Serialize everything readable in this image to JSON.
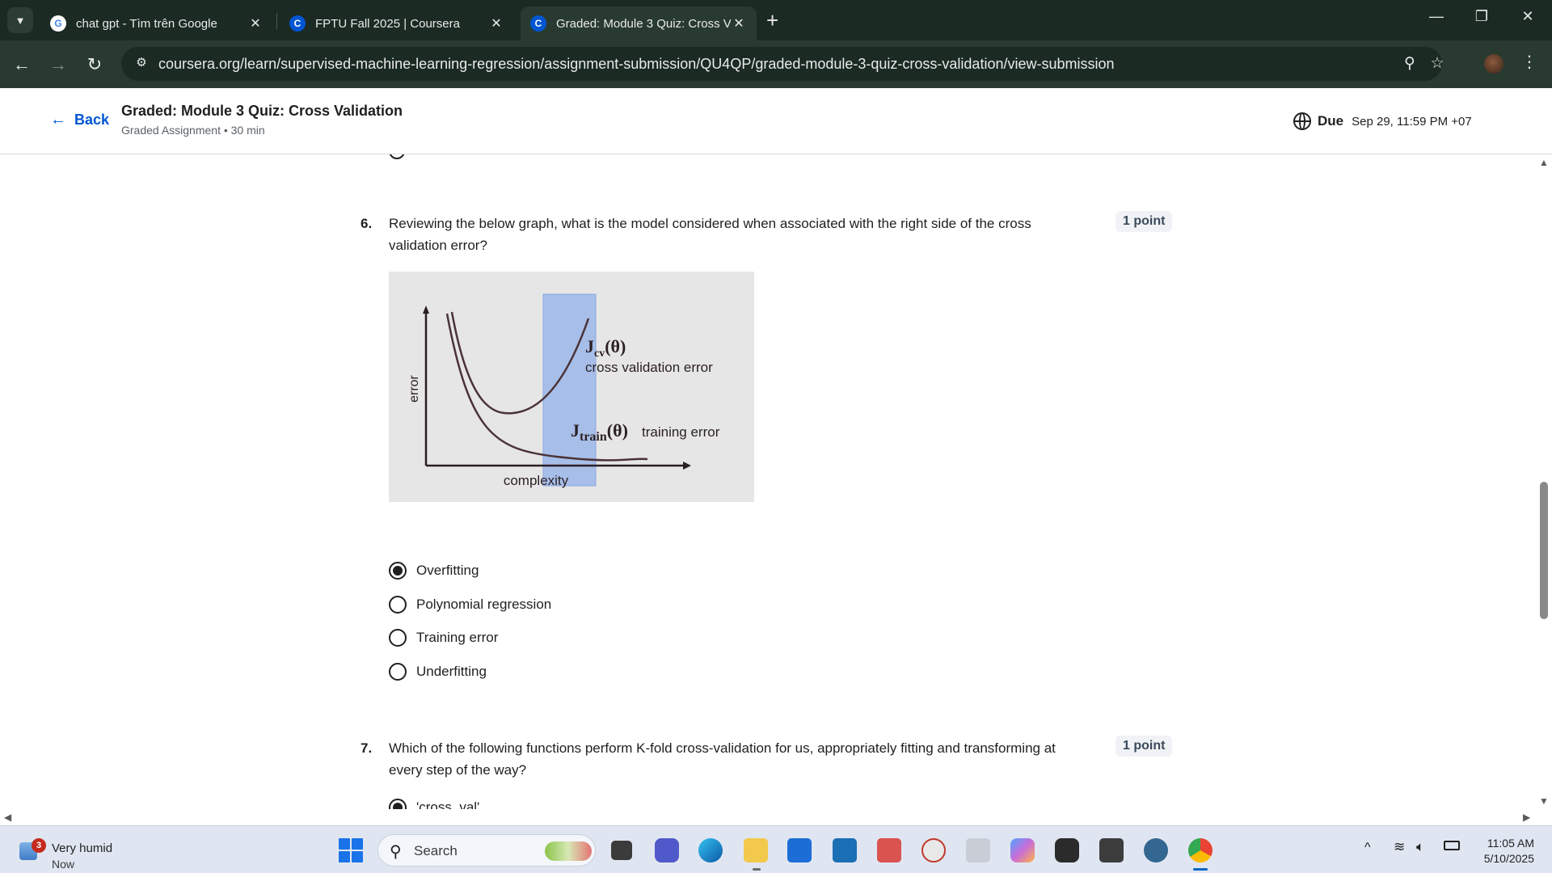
{
  "browser": {
    "tabs": [
      {
        "title": "chat gpt - Tìm trên Google",
        "favicon": "google-icon",
        "active": false
      },
      {
        "title": "FPTU Fall 2025 | Coursera",
        "favicon": "coursera-icon",
        "active": false
      },
      {
        "title": "Graded: Module 3 Quiz: Cross V",
        "favicon": "coursera-icon",
        "active": true
      }
    ],
    "url": "coursera.org/learn/supervised-machine-learning-regression/assignment-submission/QU4QP/graded-module-3-quiz-cross-validation/view-submission"
  },
  "header": {
    "back_label": "Back",
    "title": "Graded: Module 3 Quiz: Cross Validation",
    "subtitle": "Graded Assignment • 30 min",
    "due_label": "Due",
    "due_date": "Sep 29, 11:59 PM +07"
  },
  "questions": [
    {
      "number": "6.",
      "text": "Reviewing the below graph, what is the model considered when associated with the right side of the cross validation error?",
      "points": "1 point",
      "figure": {
        "ylabel": "error",
        "xlabel": "complexity",
        "cv_label_main": "J",
        "cv_label_sub": "cv",
        "cv_label_arg": "(θ)",
        "cv_caption": "cross validation error",
        "train_label_main": "J",
        "train_label_sub": "train",
        "train_label_arg": "(θ)",
        "train_caption": "training error",
        "highlight_color": "#9db8ea"
      },
      "options": [
        {
          "label": "Overfitting",
          "selected": true
        },
        {
          "label": "Polynomial regression",
          "selected": false
        },
        {
          "label": "Training error",
          "selected": false
        },
        {
          "label": "Underfitting",
          "selected": false
        }
      ]
    },
    {
      "number": "7.",
      "text": "Which of the following functions perform K-fold cross-validation for us, appropriately fitting and transforming at every step of the way?",
      "points": "1 point",
      "first_option": "'cross_val'"
    }
  ],
  "taskbar": {
    "weather_badge": "3",
    "weather_title": "Very humid",
    "weather_sub": "Now",
    "search_placeholder": "Search",
    "time": "11:05 AM",
    "date": "5/10/2025"
  },
  "colors": {
    "accent": "#0056d2",
    "tabbar": "#1b2a22",
    "toolbar": "#293a30"
  }
}
